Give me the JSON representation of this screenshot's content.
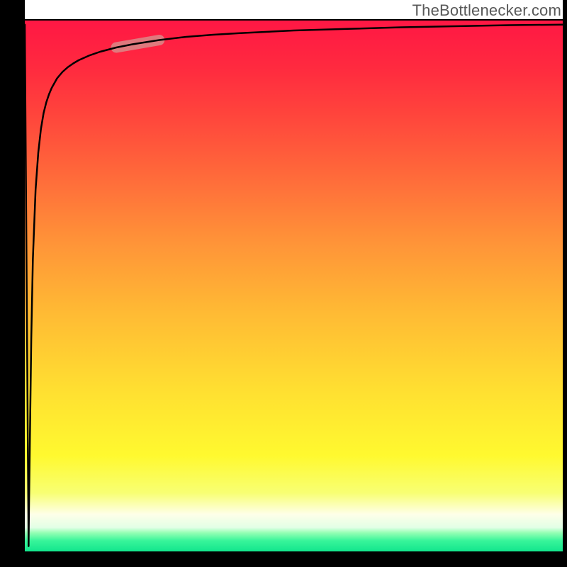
{
  "attribution": "TheBottlenecker.com",
  "chart_data": {
    "type": "line",
    "title": "",
    "xlabel": "",
    "ylabel": "",
    "xlim": [
      0,
      100
    ],
    "ylim": [
      0,
      100
    ],
    "grid": false,
    "legend": false,
    "annotations": [],
    "background_gradient": {
      "direction": "vertical_top_to_bottom",
      "stops": [
        {
          "pos": 0.0,
          "color": "#ff1744"
        },
        {
          "pos": 0.09,
          "color": "#ff2a3f"
        },
        {
          "pos": 0.18,
          "color": "#ff453c"
        },
        {
          "pos": 0.3,
          "color": "#ff6c3a"
        },
        {
          "pos": 0.42,
          "color": "#ff9438"
        },
        {
          "pos": 0.55,
          "color": "#ffba34"
        },
        {
          "pos": 0.7,
          "color": "#ffe031"
        },
        {
          "pos": 0.82,
          "color": "#fff92f"
        },
        {
          "pos": 0.89,
          "color": "#f8ff73"
        },
        {
          "pos": 0.93,
          "color": "#feffe8"
        },
        {
          "pos": 0.955,
          "color": "#e2ffe6"
        },
        {
          "pos": 0.965,
          "color": "#94ffb4"
        },
        {
          "pos": 0.98,
          "color": "#38f59a"
        },
        {
          "pos": 1.0,
          "color": "#12e58d"
        }
      ]
    },
    "series": [
      {
        "name": "curve",
        "type": "line",
        "color": "#000000",
        "stroke_width": 2.5,
        "x": [
          0.7,
          0.8,
          1.0,
          1.2,
          1.5,
          2.0,
          2.5,
          3.0,
          3.5,
          4.0,
          4.5,
          5.0,
          6.0,
          7.0,
          8.0,
          9.0,
          10.0,
          12.0,
          14.0,
          17.0,
          20.0,
          25.0,
          30.0,
          35.0,
          40.0,
          50.0,
          60.0,
          70.0,
          80.0,
          90.0,
          100.0
        ],
        "y": [
          1.0,
          10.0,
          25.0,
          40.0,
          55.0,
          68.0,
          75.0,
          79.5,
          82.5,
          84.5,
          86.0,
          87.2,
          89.0,
          90.2,
          91.1,
          91.8,
          92.4,
          93.3,
          94.0,
          94.8,
          95.4,
          96.2,
          96.8,
          97.2,
          97.5,
          98.0,
          98.3,
          98.6,
          98.8,
          99.0,
          99.1
        ]
      },
      {
        "name": "core-0-spike",
        "type": "line",
        "color": "#000000",
        "stroke_width": 2.5,
        "x": [
          0.0,
          0.7
        ],
        "y": [
          99.1,
          1.0
        ]
      }
    ],
    "highlight": {
      "name": "emphasized-segment",
      "color": "#d98a88",
      "opacity": 0.85,
      "width": 15,
      "x_range": [
        17.0,
        25.0
      ],
      "y_range": [
        94.8,
        96.2
      ]
    }
  }
}
